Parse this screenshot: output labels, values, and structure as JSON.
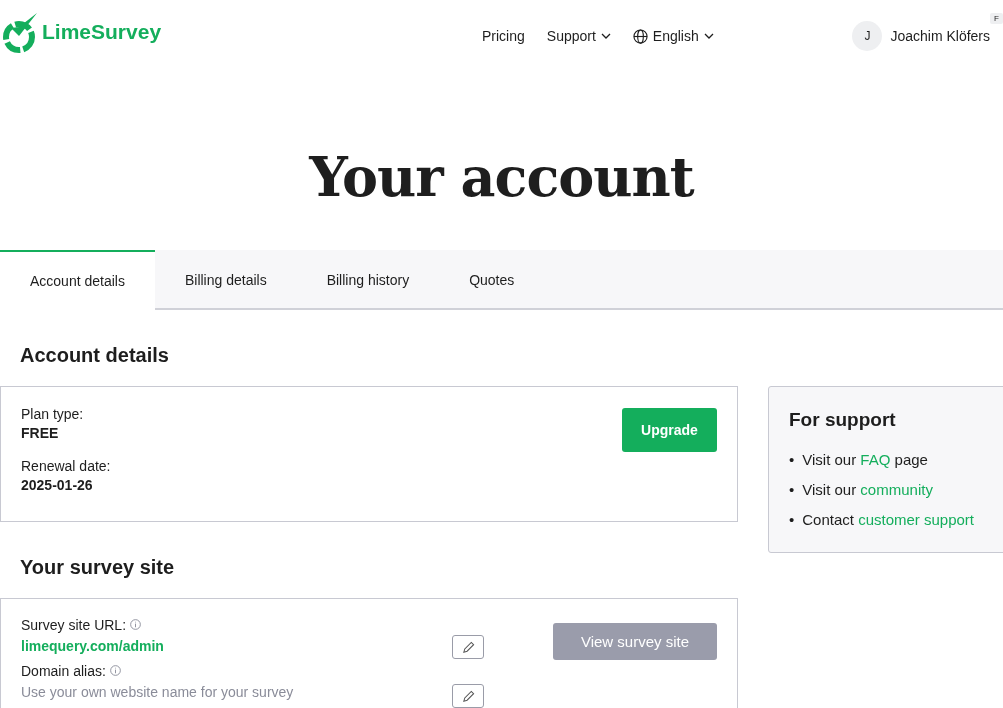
{
  "header": {
    "logo": "LimeSurvey",
    "nav": [
      {
        "label": "Pricing",
        "kind": "link"
      },
      {
        "label": "Support",
        "kind": "dropdown"
      },
      {
        "label": "English",
        "kind": "language"
      }
    ],
    "user": {
      "initial": "J",
      "name": "Joachim Klöfers",
      "badge": "F"
    }
  },
  "title": "Your account",
  "tabs": [
    {
      "label": "Account details",
      "selected": true
    },
    {
      "label": "Billing details",
      "selected": false
    },
    {
      "label": "Billing history",
      "selected": false
    },
    {
      "label": "Quotes",
      "selected": false
    }
  ],
  "account": {
    "heading": "Account details",
    "fields": [
      {
        "label": "Plan type:",
        "value": "FREE"
      },
      {
        "label": "Renewal date:",
        "value": "2025-01-26"
      }
    ],
    "button": "Upgrade"
  },
  "support": {
    "heading": "For support",
    "items": [
      {
        "marker": "•",
        "before": "Visit our",
        "link": "FAQ",
        "after": "page"
      },
      {
        "marker": "•",
        "before": "Visit our",
        "link": "community"
      },
      {
        "marker": "•",
        "before": "Contact",
        "link": "customer support"
      }
    ]
  },
  "site": {
    "heading": "Your survey site",
    "url_label": "Survey site URL:",
    "url": "limequery.com/admin",
    "alias_label": "Domain alias:",
    "alias_placeholder": "Use your own website name for your survey",
    "button": "View survey site",
    "button_disabled": true
  }
}
